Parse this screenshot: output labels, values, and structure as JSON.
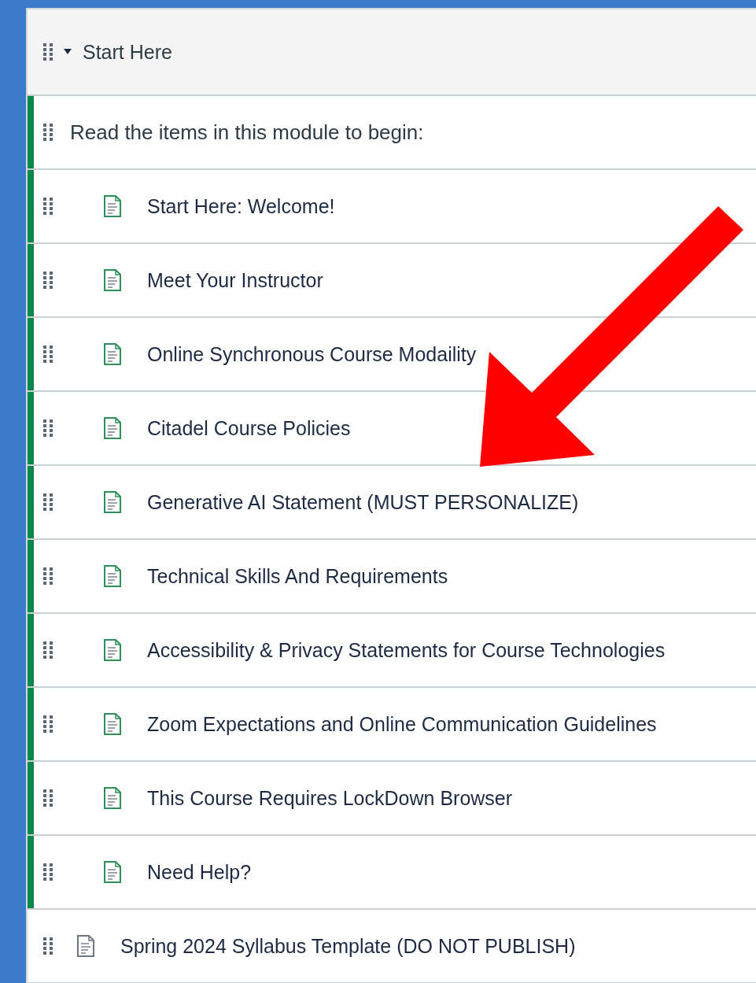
{
  "module": {
    "title": "Start Here",
    "expanded": true
  },
  "items": [
    {
      "kind": "subheader",
      "title": "Read the items in this module to begin:",
      "indented": false,
      "highlighted": true
    },
    {
      "kind": "page",
      "title": "Start Here: Welcome!",
      "indented": true,
      "highlighted": true
    },
    {
      "kind": "page",
      "title": "Meet Your Instructor",
      "indented": true,
      "highlighted": true
    },
    {
      "kind": "page",
      "title": "Online Synchronous Course Modaility",
      "indented": true,
      "highlighted": true
    },
    {
      "kind": "page",
      "title": "Citadel Course Policies",
      "indented": true,
      "highlighted": true
    },
    {
      "kind": "page",
      "title": "Generative AI Statement (MUST PERSONALIZE)",
      "indented": true,
      "highlighted": true
    },
    {
      "kind": "page",
      "title": "Technical Skills And Requirements",
      "indented": true,
      "highlighted": true
    },
    {
      "kind": "page",
      "title": "Accessibility & Privacy Statements for Course Technologies",
      "indented": true,
      "highlighted": true
    },
    {
      "kind": "page",
      "title": "Zoom Expectations and Online Communication Guidelines",
      "indented": true,
      "highlighted": true
    },
    {
      "kind": "page",
      "title": "This Course Requires LockDown Browser",
      "indented": true,
      "highlighted": true
    },
    {
      "kind": "page",
      "title": "Need Help?",
      "indented": true,
      "highlighted": true
    },
    {
      "kind": "page",
      "title": "Spring 2024 Syllabus Template (DO NOT PUBLISH)",
      "indented": false,
      "highlighted": false
    }
  ]
}
